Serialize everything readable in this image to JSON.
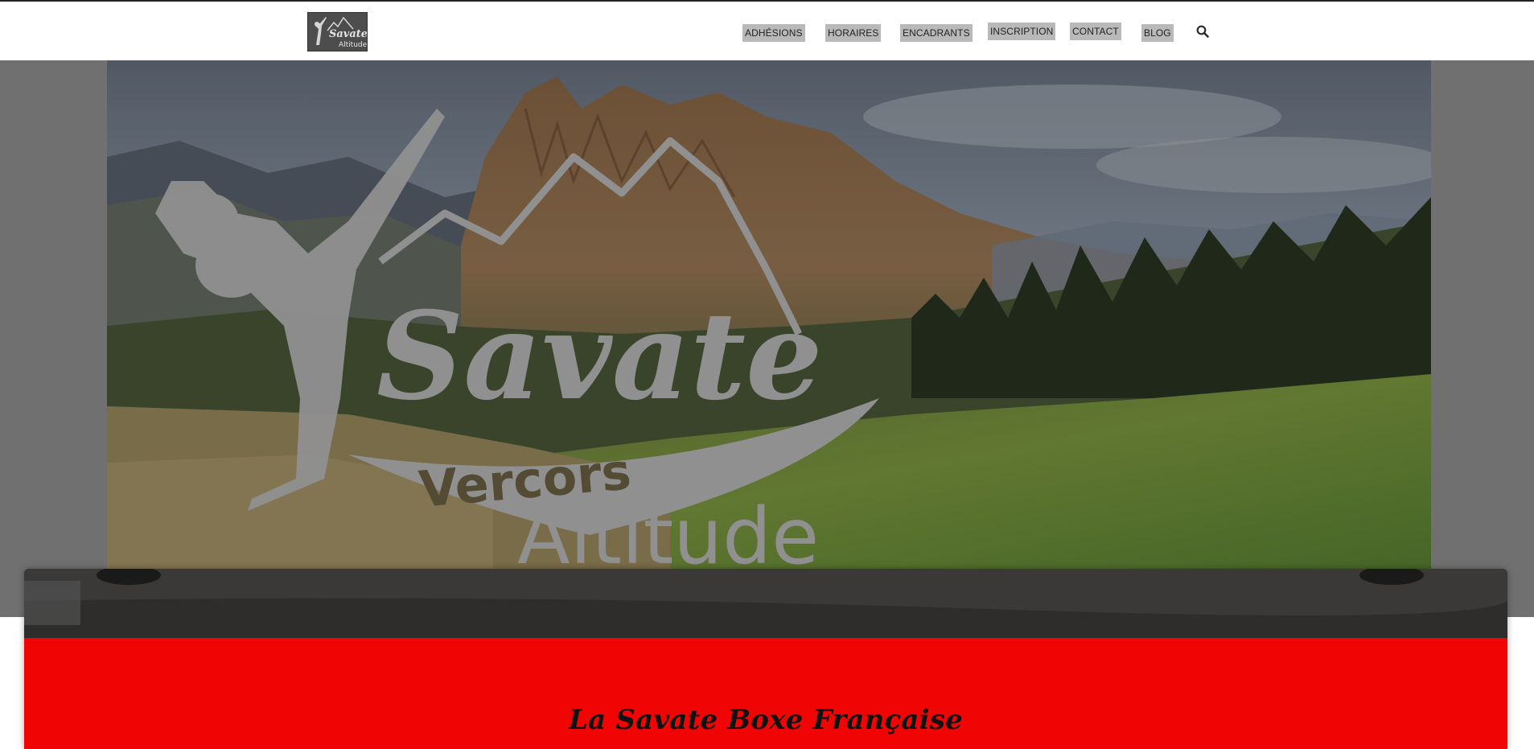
{
  "brand": {
    "logo_alt": "Savate Altitude logo",
    "logo_text_top": "Savate",
    "logo_text_bottom": "Altitude"
  },
  "nav": {
    "items": [
      {
        "label": "ADHÉSIONS"
      },
      {
        "label": "HORAIRES"
      },
      {
        "label": "ENCADRANTS"
      },
      {
        "label": "INSCRIPTION"
      },
      {
        "label": "CONTACT"
      },
      {
        "label": "BLOG"
      }
    ],
    "search_icon": "search-icon"
  },
  "hero": {
    "logo_word_main": "Savate",
    "logo_word_sub1": "Vercors",
    "logo_word_sub2": "Altitude"
  },
  "section": {
    "title": "La Savate Boxe Française"
  },
  "colors": {
    "accent_red": "#f10404",
    "nav_bg": "#ffffff",
    "nav_item_bg": "#b9b9b9"
  }
}
